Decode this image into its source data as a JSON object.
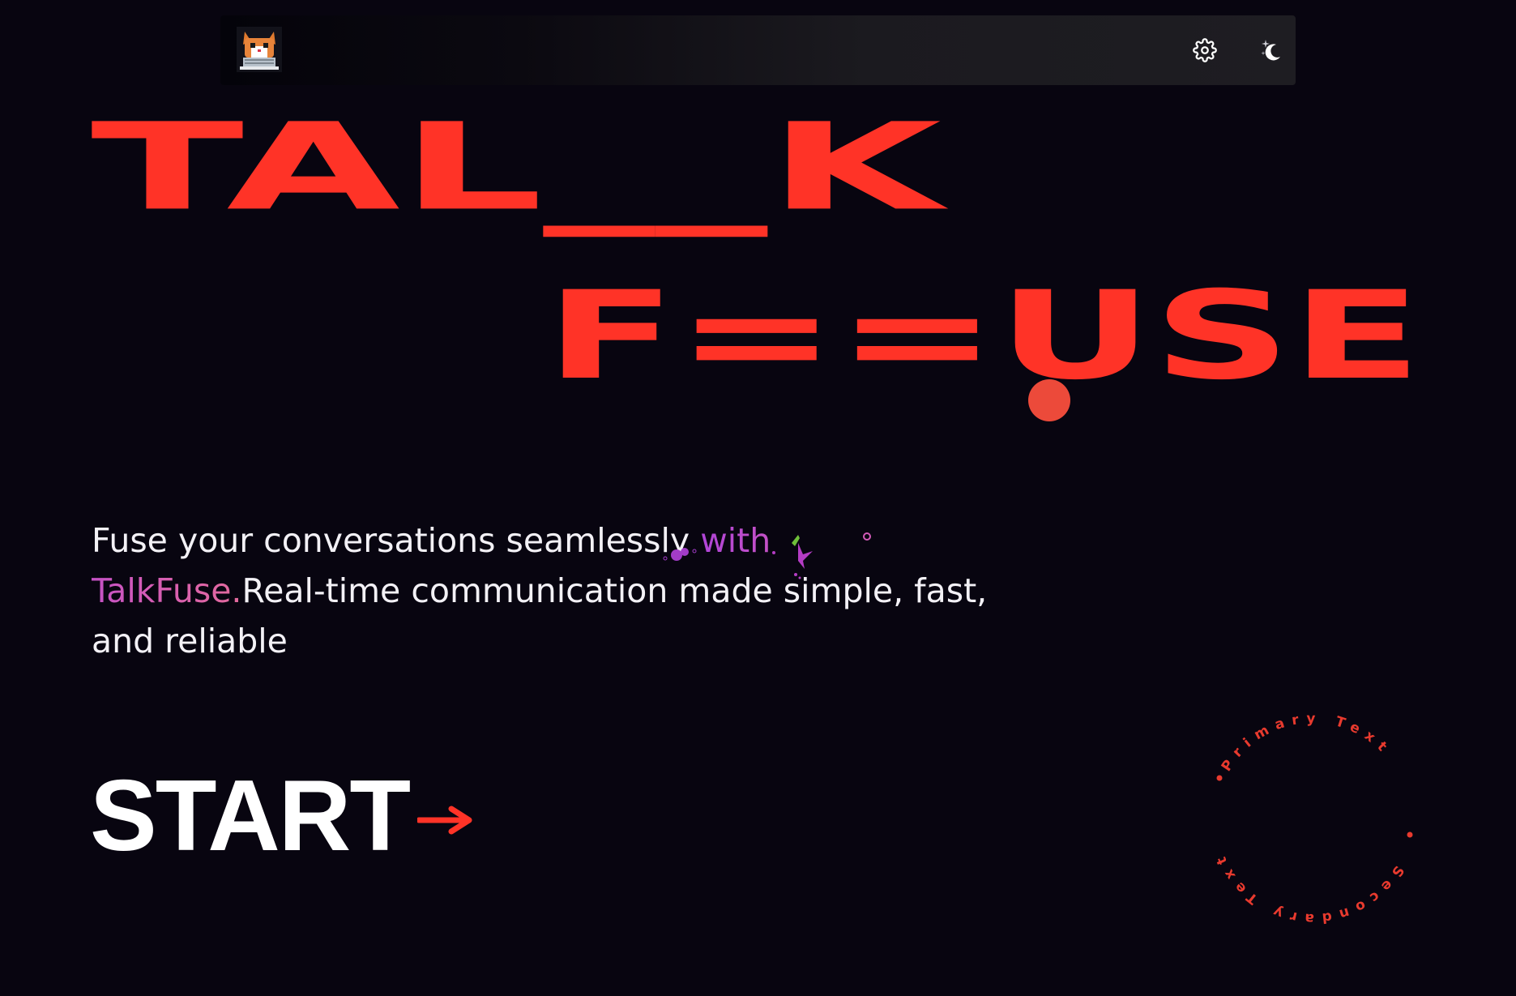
{
  "navbar": {
    "logo_icon": "pixel-cat-at-laptop-logo",
    "settings_icon": "gear-icon",
    "theme_icon": "moon-stars-icon"
  },
  "hero": {
    "word1": "TAL__K",
    "word2": "F==USE",
    "tagline_before": "Fuse your conversations seamlessly ",
    "tagline_accent": "with TalkFuse.",
    "tagline_after": "Real-time communication made simple, fast, and reliable",
    "start_label": "START"
  },
  "badge": {
    "primary_text": "Primary Text",
    "secondary_text": "Secondary Text"
  },
  "colors": {
    "background": "#080510",
    "brand_red": "#ff3327",
    "accent_purple": "#b044d8",
    "accent_pink": "#e36a9c"
  }
}
